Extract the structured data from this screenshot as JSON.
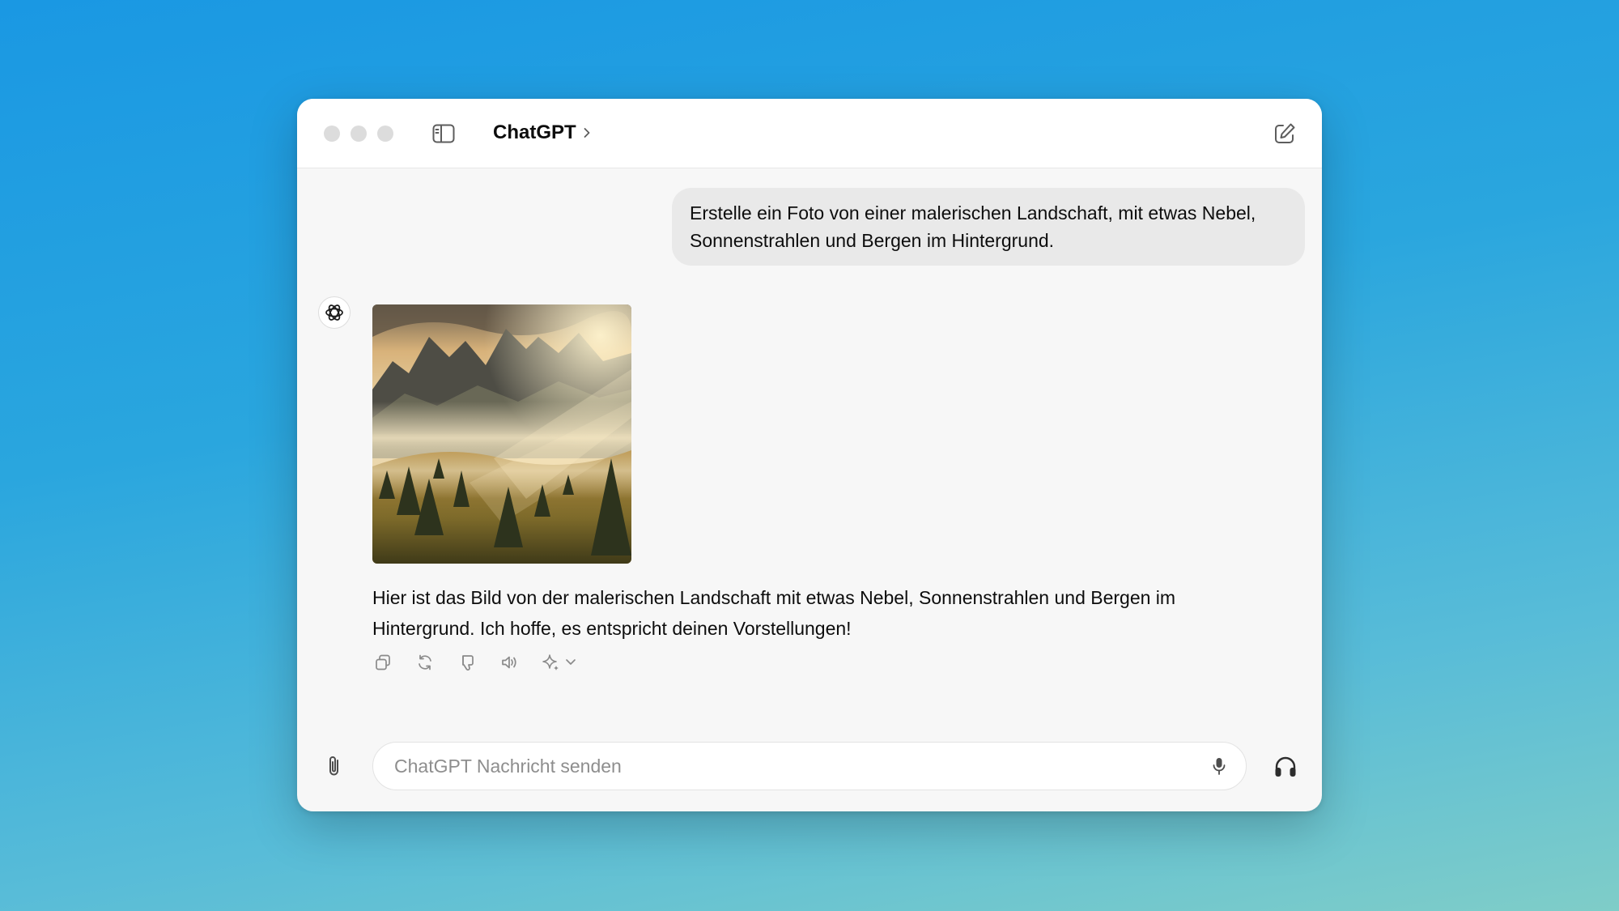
{
  "window": {
    "title": "ChatGPT"
  },
  "conversation": {
    "user_message": "Erstelle ein Foto von einer malerischen Landschaft, mit etwas Nebel, Sonnenstrahlen und Bergen im Hintergrund.",
    "assistant_message": "Hier ist das Bild von der malerischen Landschaft mit etwas Nebel, Sonnenstrahlen und Bergen im Hintergrund. Ich hoffe, es entspricht deinen Vorstellungen!"
  },
  "composer": {
    "placeholder": "ChatGPT Nachricht senden"
  },
  "icons": {
    "sidebar": "sidebar-toggle-icon",
    "chevron": "chevron-right-icon",
    "new_chat": "compose-icon",
    "avatar": "openai-logo-icon",
    "copy": "copy-icon",
    "regenerate": "refresh-icon",
    "dislike": "thumbs-down-icon",
    "read_aloud": "speaker-icon",
    "model": "sparkle-icon",
    "attach": "paperclip-icon",
    "mic": "microphone-icon",
    "voice": "headphones-icon"
  },
  "colors": {
    "background_top": "#1a98e3",
    "background_bottom": "#7fcdc8",
    "window": "#f7f7f7",
    "user_bubble": "#e9e9e9",
    "text": "#0d0d0d"
  }
}
